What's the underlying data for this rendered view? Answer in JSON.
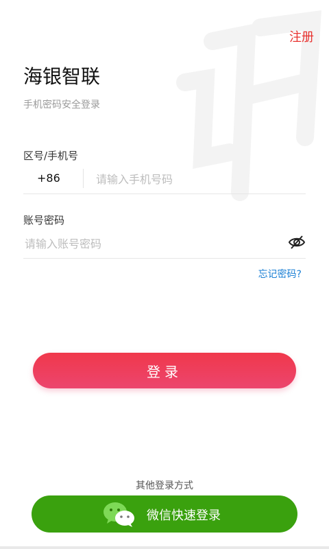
{
  "header": {
    "register_label": "注册"
  },
  "brand": {
    "title": "海银智联",
    "subtitle": "手机密码安全登录"
  },
  "phone": {
    "label": "区号/手机号",
    "prefix": "+86",
    "placeholder": "请输入手机号码",
    "value": ""
  },
  "password": {
    "label": "账号密码",
    "placeholder": "请输入账号密码",
    "value": ""
  },
  "forgot_label": "忘记密码?",
  "login_label": "登录",
  "other_methods_label": "其他登录方式",
  "wechat_label": "微信快速登录",
  "colors": {
    "accent": "#e8322f",
    "link": "#1a7fd4",
    "wechat": "#3aa10e",
    "login_gradient_start": "#f0384b",
    "login_gradient_end": "#ec456e"
  },
  "icons": {
    "eye": "eye-off-icon",
    "wechat": "wechat-icon"
  }
}
